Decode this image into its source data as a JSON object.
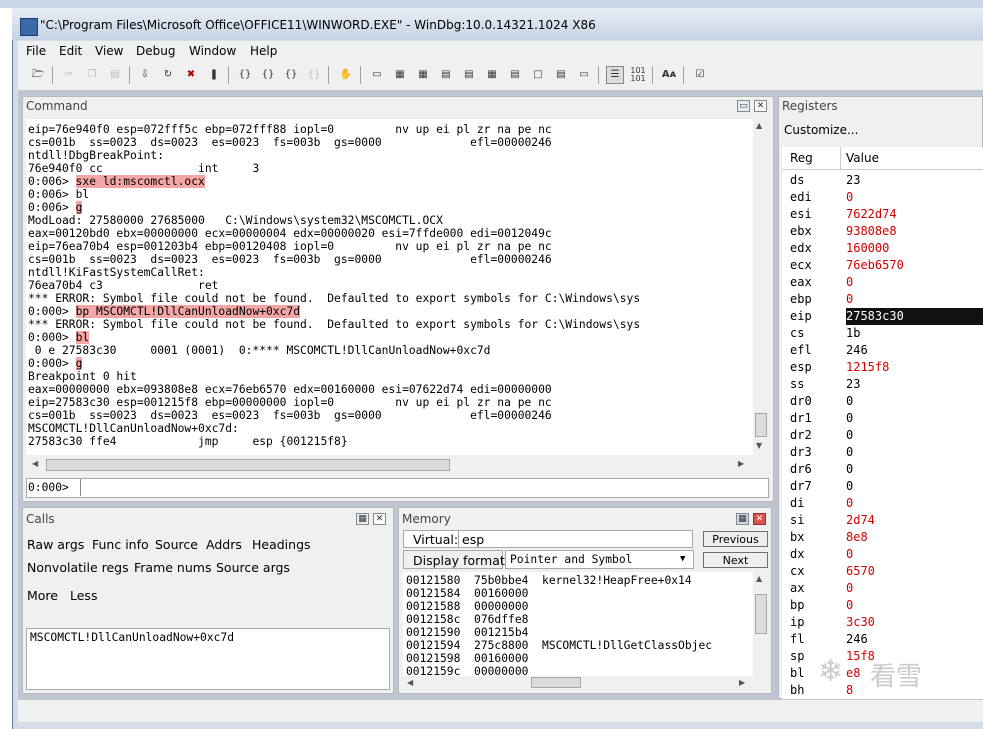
{
  "window": {
    "title": "\"C:\\Program Files\\Microsoft Office\\OFFICE11\\WINWORD.EXE\"  - WinDbg:10.0.14321.1024 X86"
  },
  "menu": [
    "File",
    "Edit",
    "View",
    "Debug",
    "Window",
    "Help"
  ],
  "command": {
    "title": "Command",
    "lines": [
      {
        "text": "eip=76e940f0 esp=072fff5c ebp=072fff88 iopl=0         nv up ei pl zr na pe nc"
      },
      {
        "text": "cs=001b  ss=0023  ds=0023  es=0023  fs=003b  gs=0000             efl=00000246"
      },
      {
        "text": "ntdll!DbgBreakPoint:"
      },
      {
        "text": "76e940f0 cc              int     3"
      },
      {
        "prompt": "0:006> ",
        "cmd": "sxe ld:mscomctl.ocx",
        "hl": true
      },
      {
        "prompt": "0:006> ",
        "cmd": "bl",
        "hl": false
      },
      {
        "prompt": "0:006> ",
        "cmd": "g",
        "hl": true
      },
      {
        "text": "ModLoad: 27580000 27685000   C:\\Windows\\system32\\MSCOMCTL.OCX"
      },
      {
        "text": "eax=00120bd0 ebx=00000000 ecx=00000004 edx=00000020 esi=7ffde000 edi=0012049c"
      },
      {
        "text": "eip=76ea70b4 esp=001203b4 ebp=00120408 iopl=0         nv up ei pl zr na pe nc"
      },
      {
        "text": "cs=001b  ss=0023  ds=0023  es=0023  fs=003b  gs=0000             efl=00000246"
      },
      {
        "text": "ntdll!KiFastSystemCallRet:"
      },
      {
        "text": "76ea70b4 c3              ret"
      },
      {
        "text": "*** ERROR: Symbol file could not be found.  Defaulted to export symbols for C:\\Windows\\sys"
      },
      {
        "prompt": "0:000> ",
        "cmd": "bp MSCOMCTL!DllCanUnloadNow+0xc7d",
        "hl": true
      },
      {
        "text": "*** ERROR: Symbol file could not be found.  Defaulted to export symbols for C:\\Windows\\sys"
      },
      {
        "prompt": "0:000> ",
        "cmd": "bl",
        "hl": true
      },
      {
        "text": " 0 e 27583c30     0001 (0001)  0:**** MSCOMCTL!DllCanUnloadNow+0xc7d"
      },
      {
        "prompt": "0:000> ",
        "cmd": "g",
        "hl": true
      },
      {
        "text": "Breakpoint 0 hit"
      },
      {
        "text": "eax=00000000 ebx=093808e8 ecx=76eb6570 edx=00160000 esi=07622d74 edi=00000000"
      },
      {
        "text": "eip=27583c30 esp=001215f8 ebp=00000000 iopl=0         nv up ei pl zr na pe nc"
      },
      {
        "text": "cs=001b  ss=0023  ds=0023  es=0023  fs=003b  gs=0000             efl=00000246"
      },
      {
        "text": "MSCOMCTL!DllCanUnloadNow+0xc7d:"
      },
      {
        "text": "27583c30 ffe4            jmp     esp {001215f8}"
      }
    ],
    "input_prompt": "0:000>",
    "input_value": ""
  },
  "registers": {
    "title": "Registers",
    "customize": "Customize...",
    "col_reg": "Reg",
    "col_value": "Value",
    "rows": [
      {
        "name": "ds",
        "value": "23",
        "changed": false
      },
      {
        "name": "edi",
        "value": "0",
        "changed": true
      },
      {
        "name": "esi",
        "value": "7622d74",
        "changed": true
      },
      {
        "name": "ebx",
        "value": "93808e8",
        "changed": true
      },
      {
        "name": "edx",
        "value": "160000",
        "changed": true
      },
      {
        "name": "ecx",
        "value": "76eb6570",
        "changed": true
      },
      {
        "name": "eax",
        "value": "0",
        "changed": true
      },
      {
        "name": "ebp",
        "value": "0",
        "changed": true
      },
      {
        "name": "eip",
        "value": "27583c30",
        "changed": true,
        "selected": true
      },
      {
        "name": "cs",
        "value": "1b",
        "changed": false
      },
      {
        "name": "efl",
        "value": "246",
        "changed": false
      },
      {
        "name": "esp",
        "value": "1215f8",
        "changed": true
      },
      {
        "name": "ss",
        "value": "23",
        "changed": false
      },
      {
        "name": "dr0",
        "value": "0",
        "changed": false
      },
      {
        "name": "dr1",
        "value": "0",
        "changed": false
      },
      {
        "name": "dr2",
        "value": "0",
        "changed": false
      },
      {
        "name": "dr3",
        "value": "0",
        "changed": false
      },
      {
        "name": "dr6",
        "value": "0",
        "changed": false
      },
      {
        "name": "dr7",
        "value": "0",
        "changed": false
      },
      {
        "name": "di",
        "value": "0",
        "changed": true
      },
      {
        "name": "si",
        "value": "2d74",
        "changed": true
      },
      {
        "name": "bx",
        "value": "8e8",
        "changed": true
      },
      {
        "name": "dx",
        "value": "0",
        "changed": true
      },
      {
        "name": "cx",
        "value": "6570",
        "changed": true
      },
      {
        "name": "ax",
        "value": "0",
        "changed": true
      },
      {
        "name": "bp",
        "value": "0",
        "changed": true
      },
      {
        "name": "ip",
        "value": "3c30",
        "changed": true
      },
      {
        "name": "fl",
        "value": "246",
        "changed": false
      },
      {
        "name": "sp",
        "value": "15f8",
        "changed": true
      },
      {
        "name": "bl",
        "value": "e8",
        "changed": true
      },
      {
        "name": "bh",
        "value": "8",
        "changed": true
      }
    ]
  },
  "calls": {
    "title": "Calls",
    "options_row1": [
      "Raw args",
      "Func info",
      "Source",
      "Addrs",
      "Headings"
    ],
    "options_row2": [
      "Nonvolatile regs",
      "Frame nums",
      "Source args"
    ],
    "more": "More",
    "less": "Less",
    "frames": [
      "MSCOMCTL!DllCanUnloadNow+0xc7d"
    ]
  },
  "memory": {
    "title": "Memory",
    "virtual_label": "Virtual:",
    "virtual_value": "esp",
    "previous": "Previous",
    "display_format_label": "Display format:",
    "display_format_value": "Pointer and Symbol",
    "next": "Next",
    "lines": [
      "00121580  75b0bbe4  kernel32!HeapFree+0x14",
      "00121584  00160000",
      "00121588  00000000",
      "0012158c  076dffe8",
      "00121590  001215b4",
      "00121594  275c8800  MSCOMCTL!DllGetClassObjec",
      "00121598  00160000",
      "0012159c  00000000"
    ]
  },
  "colors": {
    "highlight": "#f4a6a6",
    "changed": "#d00000",
    "selected_bg": "#111111"
  },
  "watermark": "看雪"
}
